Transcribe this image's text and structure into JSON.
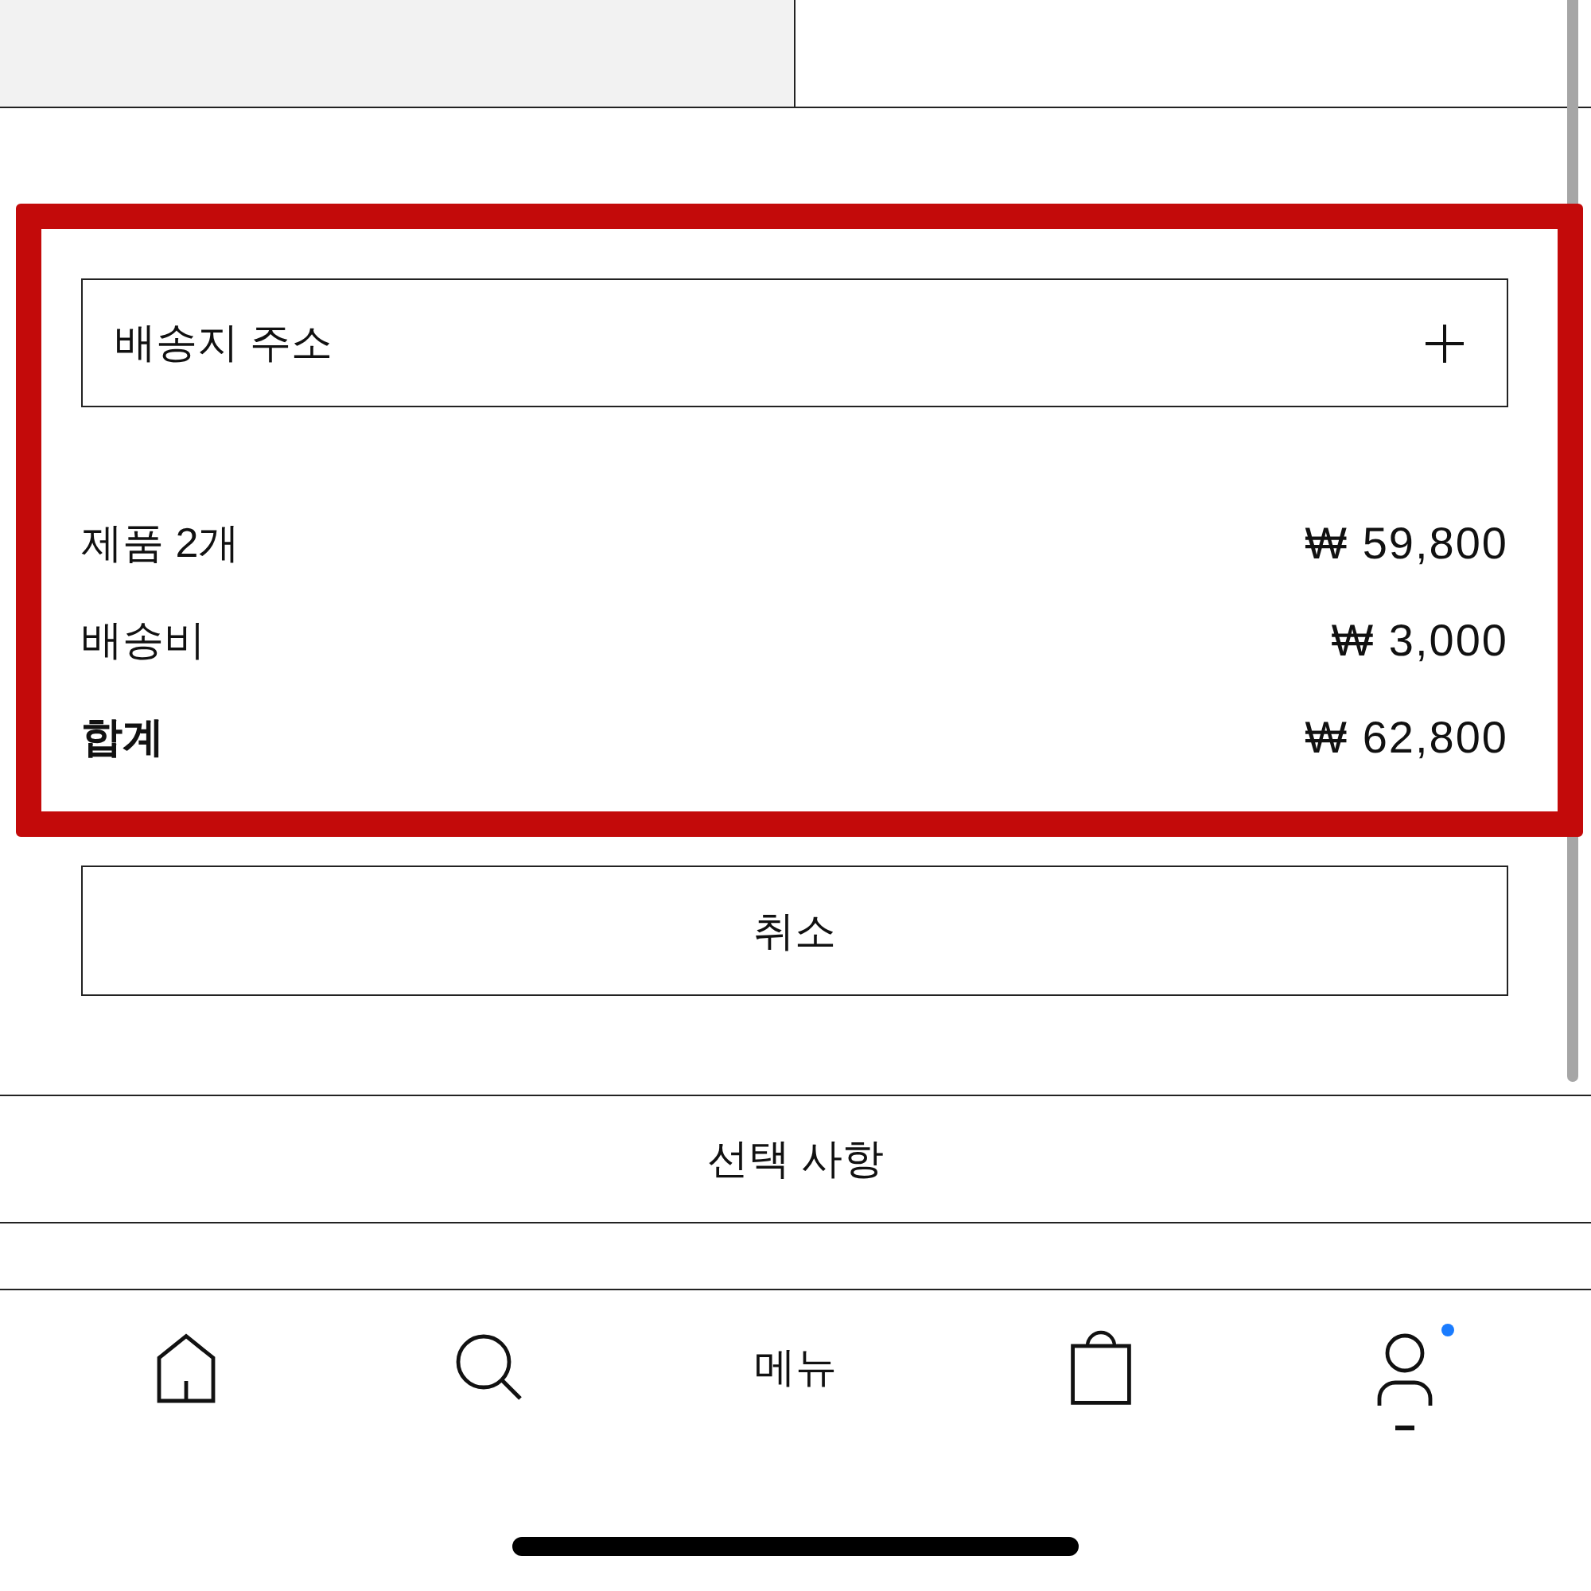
{
  "address": {
    "label": "배송지 주소",
    "expanded": false
  },
  "summary": [
    {
      "kind": "line",
      "label": "제품 2개",
      "amount": "₩ 59,800"
    },
    {
      "kind": "line",
      "label": "배송비",
      "amount": "₩ 3,000"
    },
    {
      "kind": "total",
      "label": "합계",
      "amount": "₩ 62,800"
    }
  ],
  "cancel_button": {
    "label": "취소"
  },
  "options": {
    "label": "선택 사항"
  },
  "bottom_nav": [
    {
      "kind": "home",
      "selected": false,
      "badge": false
    },
    {
      "kind": "search",
      "selected": false,
      "badge": false
    },
    {
      "kind": "text",
      "label": "메뉴",
      "selected": false,
      "badge": false
    },
    {
      "kind": "bag",
      "selected": false,
      "badge": false
    },
    {
      "kind": "account",
      "selected": true,
      "badge": true
    }
  ]
}
